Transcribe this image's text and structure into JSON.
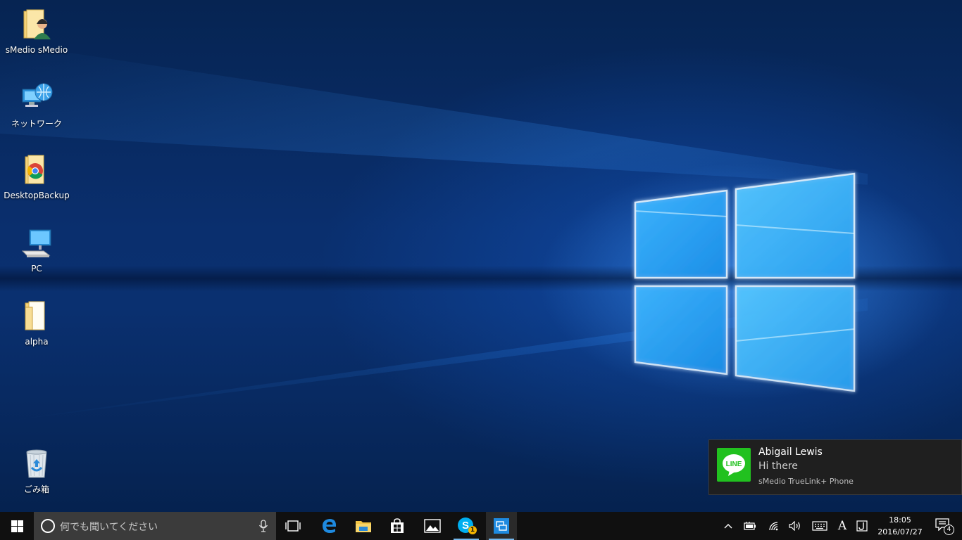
{
  "desktop": {
    "icons": [
      {
        "label": "sMedio sMedio",
        "icon": "user-folder-icon"
      },
      {
        "label": "ネットワーク",
        "icon": "network-icon"
      },
      {
        "label": "DesktopBackup",
        "icon": "chrome-folder-icon"
      },
      {
        "label": "PC",
        "icon": "computer-icon"
      },
      {
        "label": "alpha",
        "icon": "folder-icon"
      },
      {
        "label": "ごみ箱",
        "icon": "recycle-bin-icon"
      }
    ]
  },
  "notification": {
    "app_icon": "line-app-icon",
    "app_icon_text": "LINE",
    "title": "Abigail Lewis",
    "message": "Hi there",
    "source": "sMedio TrueLink+ Phone"
  },
  "taskbar": {
    "search_placeholder": "何でも聞いてください",
    "apps": [
      "task-view-icon",
      "edge-icon",
      "file-explorer-icon",
      "store-icon",
      "photos-icon",
      "skype-icon",
      "truelink-icon"
    ],
    "skype_badge": "1",
    "tray": {
      "ime_mode": "A",
      "time": "18:05",
      "date": "2016/07/27",
      "notifications_count": "4"
    }
  },
  "colors": {
    "accent": "#0078d7",
    "line_green": "#21c11f",
    "taskbar": "#101010",
    "toast_bg": "#1f1f1f"
  }
}
